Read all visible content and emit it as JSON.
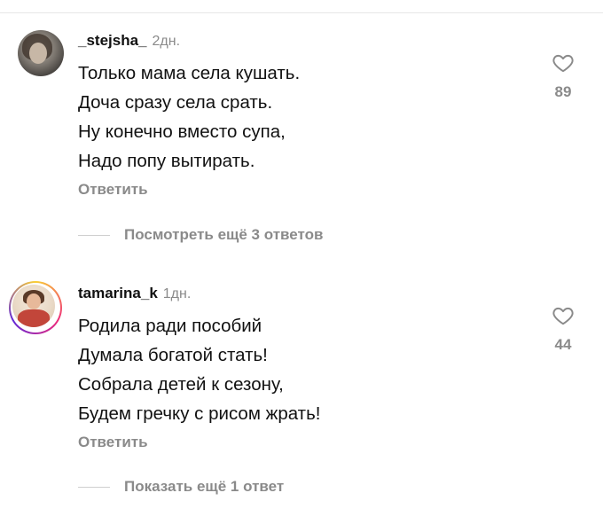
{
  "comments": [
    {
      "username": "_stejsha_",
      "timestamp": "2дн.",
      "lines": [
        "Только мама села кушать.",
        "Доча сразу села срать.",
        "Ну конечно вместо супа,",
        "Надо попу вытирать."
      ],
      "reply_label": "Ответить",
      "likes": "89",
      "more_replies_label": "Посмотреть ещё 3 ответов"
    },
    {
      "username": "tamarina_k",
      "timestamp": "1дн.",
      "lines": [
        "Родила ради пособий",
        "Думала богатой стать!",
        "Собрала детей к сезону,",
        "Будем гречку с рисом жрать!"
      ],
      "reply_label": "Ответить",
      "likes": "44",
      "more_replies_label": "Показать ещё 1 ответ"
    }
  ],
  "icons": {
    "like": "heart-outline-icon"
  },
  "colors": {
    "text": "#111111",
    "muted": "#8a8a8a",
    "divider": "#cfcfcf"
  }
}
